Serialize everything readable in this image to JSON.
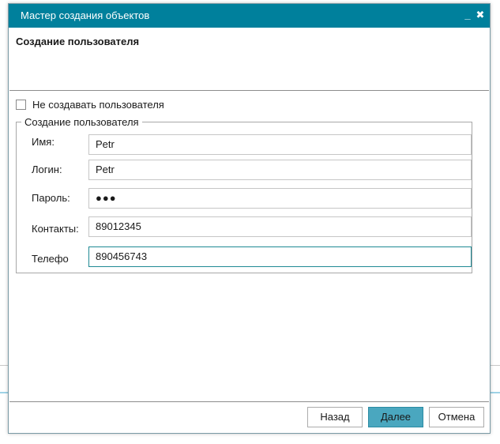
{
  "window": {
    "title": "Мастер создания объектов",
    "minimize_glyph": "_",
    "close_glyph": "✖"
  },
  "header": {
    "title": "Создание пользователя"
  },
  "options": {
    "no_create_label": "Не создавать пользователя",
    "no_create_checked": false
  },
  "user_group": {
    "legend": "Создание пользователя",
    "fields": [
      {
        "label": "Имя:",
        "value": "Petr"
      },
      {
        "label": "Логин:",
        "value": "Petr"
      },
      {
        "label": "Пароль:",
        "value": "●●●"
      },
      {
        "label": "Контакты:",
        "value": "89012345"
      },
      {
        "label": "Телефон:",
        "value": "890456743"
      }
    ]
  },
  "buttons": {
    "back": "Назад",
    "next": "Далее",
    "cancel": "Отмена"
  },
  "colors": {
    "titlebar": "#00809c",
    "primary_button": "#4aa7bf",
    "focus_border": "#1f8a94"
  }
}
